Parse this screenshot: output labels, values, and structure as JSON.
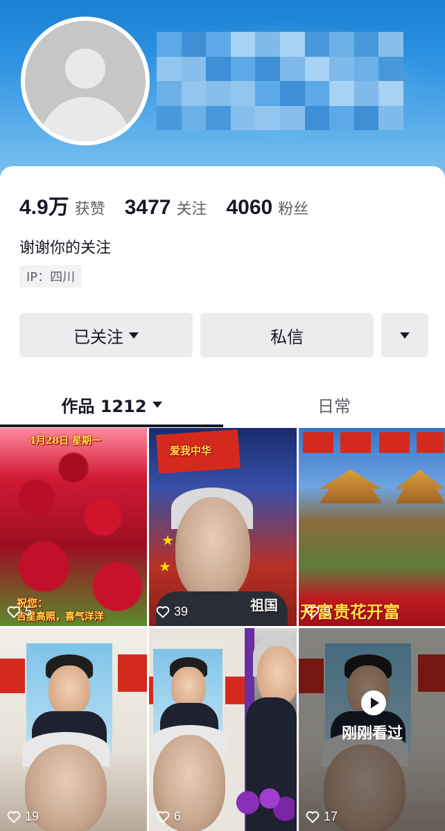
{
  "profile": {
    "avatar_icon": "default-avatar-icon",
    "stats": [
      {
        "value": "4.9万",
        "label": "获赞"
      },
      {
        "value": "3477",
        "label": "关注"
      },
      {
        "value": "4060",
        "label": "粉丝"
      }
    ],
    "bio": "谢谢你的关注",
    "ip": "IP：四川"
  },
  "actions": {
    "follow_label": "已关注",
    "message_label": "私信",
    "more_icon": "caret-down-icon"
  },
  "tabs": {
    "works_label": "作品 1212",
    "daily_label": "日常"
  },
  "videos": [
    {
      "likes": "5",
      "date_text": "4月28日 星期一",
      "caption": "祝您：",
      "caption2": "吉星高照，喜气洋洋"
    },
    {
      "likes": "39",
      "banner_text": "爱我中华",
      "corner_text": "祖国"
    },
    {
      "likes": "9",
      "banner_text": "开富贵花开富"
    },
    {
      "likes": "19"
    },
    {
      "likes": "6"
    },
    {
      "likes": "17",
      "seen_label": "刚刚看过"
    }
  ],
  "colors": {
    "header_blue": "#2f93e2",
    "button_bg": "#ebecee",
    "text_primary": "#161823",
    "text_secondary": "#5e6066"
  }
}
